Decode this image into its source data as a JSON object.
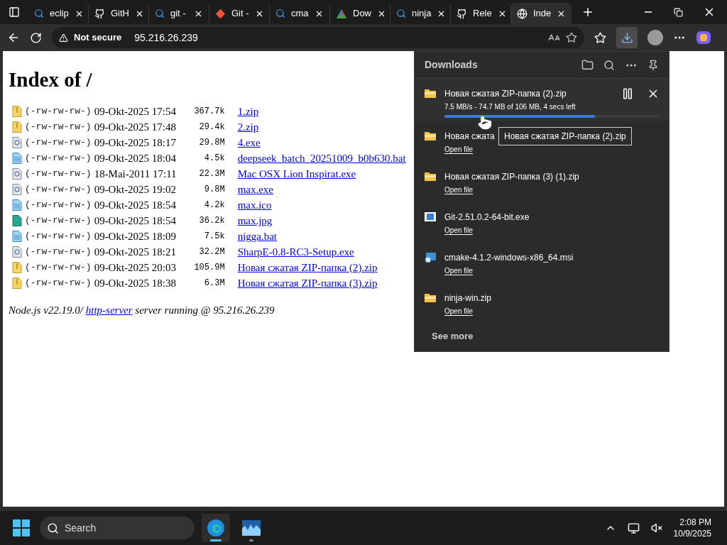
{
  "tabs": [
    {
      "kind": "search",
      "title": "eclip",
      "selected": false
    },
    {
      "kind": "github",
      "title": "GitH",
      "selected": false
    },
    {
      "kind": "search",
      "title": "git -",
      "selected": false
    },
    {
      "kind": "git",
      "title": "Git -",
      "selected": false
    },
    {
      "kind": "search",
      "title": "cma",
      "selected": false
    },
    {
      "kind": "triangle",
      "title": "Dow",
      "selected": false
    },
    {
      "kind": "search",
      "title": "ninja",
      "selected": false
    },
    {
      "kind": "github",
      "title": "Rele",
      "selected": false
    },
    {
      "kind": "globe",
      "title": "Inde",
      "selected": true
    }
  ],
  "address_bar": {
    "security": "Not secure",
    "url": "95.216.26.239"
  },
  "downloads_button": {
    "selected": true
  },
  "page": {
    "heading": "Index of /",
    "rows": [
      {
        "kind": "zip",
        "permissions": "(-rw-rw-rw-)",
        "date": "09-Okt-2025 17:54",
        "size": "367.7k",
        "name": "1.zip"
      },
      {
        "kind": "zip",
        "permissions": "(-rw-rw-rw-)",
        "date": "09-Okt-2025 17:48",
        "size": "29.4k",
        "name": "2.zip"
      },
      {
        "kind": "exe",
        "permissions": "(-rw-rw-rw-)",
        "date": "09-Okt-2025 18:17",
        "size": "29.8M",
        "name": "4.exe"
      },
      {
        "kind": "text",
        "permissions": "(-rw-rw-rw-)",
        "date": "09-Okt-2025 18:04",
        "size": "4.5k",
        "name": "deepseek_batch_20251009_b0b630.bat"
      },
      {
        "kind": "exe",
        "permissions": "(-rw-rw-rw-)",
        "date": "18-Mai-2011 17:11",
        "size": "22.3M",
        "name": "Mac OSX Lion Inspirat.exe"
      },
      {
        "kind": "exe",
        "permissions": "(-rw-rw-rw-)",
        "date": "09-Okt-2025 19:02",
        "size": "9.8M",
        "name": "max.exe"
      },
      {
        "kind": "text",
        "permissions": "(-rw-rw-rw-)",
        "date": "09-Okt-2025 18:54",
        "size": "4.2k",
        "name": "max.ico"
      },
      {
        "kind": "image",
        "permissions": "(-rw-rw-rw-)",
        "date": "09-Okt-2025 18:54",
        "size": "36.2k",
        "name": "max.jpg"
      },
      {
        "kind": "text",
        "permissions": "(-rw-rw-rw-)",
        "date": "09-Okt-2025 18:09",
        "size": "7.5k",
        "name": "nigga.bat"
      },
      {
        "kind": "exe",
        "permissions": "(-rw-rw-rw-)",
        "date": "09-Okt-2025 18:21",
        "size": "32.2M",
        "name": "SharpE-0.8-RC3-Setup.exe"
      },
      {
        "kind": "zip",
        "permissions": "(-rw-rw-rw-)",
        "date": "09-Okt-2025 20:03",
        "size": "105.9M",
        "name": "Новая сжатая ZIP-папка (2).zip"
      },
      {
        "kind": "zip",
        "permissions": "(-rw-rw-rw-)",
        "date": "09-Okt-2025 18:38",
        "size": "6.3M",
        "name": "Новая сжатая ZIP-папка (3).zip"
      }
    ],
    "footer": {
      "before": "Node.js v22.19.0/ ",
      "link": "http-server",
      "after": " server running @ 95.216.26.239"
    }
  },
  "downloads": {
    "title": "Downloads",
    "items": [
      {
        "kind": "folder",
        "name": "Новая сжатая ZIP-папка (2).zip",
        "status": "7.5 MB/s - 74.7 MB of 106 MB, 4 secs left",
        "level": 0.7
      },
      {
        "kind": "folder",
        "name": "Новая сжата",
        "action": "Open file"
      },
      {
        "kind": "folder",
        "name": "Новая сжатая ZIP-папка (3) (1).zip",
        "action": "Open file"
      },
      {
        "kind": "installer",
        "name": "Git-2.51.0.2-64-bit.exe",
        "action": "Open file"
      },
      {
        "kind": "msi",
        "name": "cmake-4.1.2-windows-x86_64.msi",
        "action": "Open file"
      },
      {
        "kind": "folder",
        "name": "ninja-win.zip",
        "action": "Open file"
      }
    ],
    "see_more": "See more",
    "tooltip": "Новая сжатая ZIP-папка (2).zip"
  },
  "taskbar": {
    "search": "Search",
    "apps": [
      {
        "kind": "edge",
        "selected": true
      },
      {
        "kind": "chart",
        "selected": false
      }
    ],
    "time": "2:08 PM",
    "date": "10/9/2025"
  }
}
